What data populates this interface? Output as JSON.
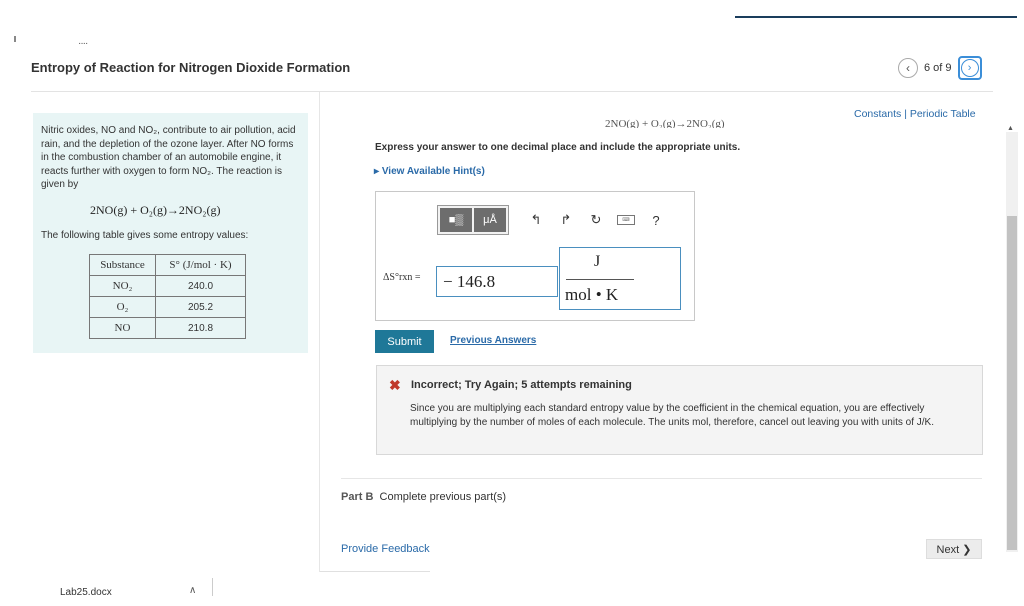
{
  "header": {
    "title": "Entropy of Reaction for Nitrogen Dioxide Formation",
    "pager": "6 of 9",
    "top_dots": "····"
  },
  "intro": {
    "paragraph": "Nitric oxides, NO and NO₂, contribute to air pollution, acid rain, and the depletion of the ozone layer. After NO forms in the combustion chamber of an automobile engine, it reacts further with oxygen to form NO₂. The reaction is given by",
    "equation": "2NO(g) + O₂(g)→2NO₂(g)",
    "table_intro": "The following table gives some entropy values:",
    "table": {
      "headers": [
        "Substance",
        "S° (J/mol · K)"
      ],
      "rows": [
        {
          "substance": "NO₂",
          "value": "240.0"
        },
        {
          "substance": "O₂",
          "value": "205.2"
        },
        {
          "substance": "NO",
          "value": "210.8"
        }
      ]
    }
  },
  "question": {
    "links": "Constants | Periodic Table",
    "partial_equation": "2NO(g) + O₂(g)→2NO₂(g)",
    "instruction": "Express your answer to one decimal place and include the appropriate units.",
    "hints": "View Available Hint(s)",
    "toolbar": {
      "template_label": "■▒",
      "units_label": "μÅ",
      "undo": "↰",
      "redo": "↱",
      "reset": "↻",
      "help": "?"
    },
    "answer_label": "ΔS°rxn =",
    "answer_value": "− 146.8",
    "units_numerator": "J",
    "units_denominator": "mol • K",
    "submit": "Submit",
    "previous_answers": "Previous Answers"
  },
  "feedback": {
    "icon": "✖",
    "heading": "Incorrect; Try Again; 5 attempts remaining",
    "explanation": "Since you are multiplying each standard entropy value by the coefficient in the chemical equation, you are effectively multiplying by the number of moles of each molecule. The units mol, therefore, cancel out leaving you with units of J/K."
  },
  "part_b": {
    "label": "Part B",
    "text": "Complete previous part(s)"
  },
  "footer": {
    "provide_feedback": "Provide Feedback",
    "next": "Next ❯"
  },
  "taskbar": {
    "file": "Lab25.docx",
    "caret": "∧"
  },
  "colors": {
    "accent": "#2a6aa8",
    "submit": "#1f7898",
    "intro_bg": "#e8f5f5",
    "error": "#c0392b"
  }
}
